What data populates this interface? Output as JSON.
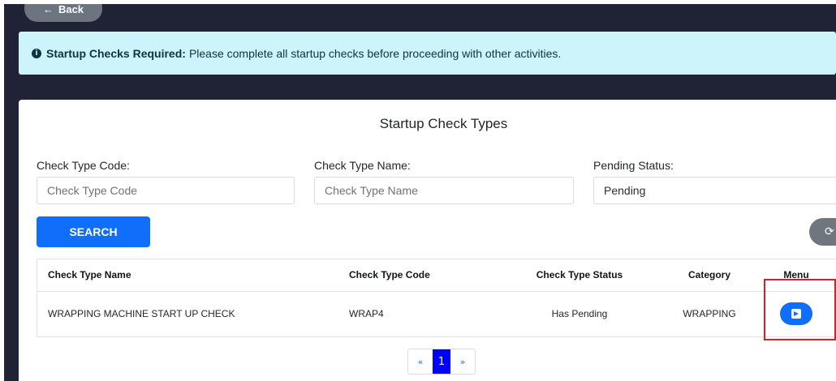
{
  "back_button": {
    "label": "Back",
    "icon": "arrow-left-icon"
  },
  "alert": {
    "icon": "info-icon",
    "title": "Startup Checks Required:",
    "message": "Please complete all startup checks before proceeding with other activities."
  },
  "card": {
    "title": "Startup Check Types",
    "filters": {
      "code": {
        "label": "Check Type Code:",
        "placeholder": "Check Type Code",
        "value": ""
      },
      "name": {
        "label": "Check Type Name:",
        "placeholder": "Check Type Name",
        "value": ""
      },
      "status": {
        "label": "Pending Status:",
        "value": "Pending"
      }
    },
    "search_label": "SEARCH",
    "refresh_icon": "refresh-icon"
  },
  "table": {
    "headers": [
      "Check Type Name",
      "Check Type Code",
      "Check Type Status",
      "Category",
      "Menu"
    ],
    "rows": [
      {
        "name": "WRAPPING MACHINE START UP CHECK",
        "code": "WRAP4",
        "status": "Has Pending",
        "category": "WRAPPING",
        "menu_icon": "enter-icon"
      }
    ]
  },
  "pagination": {
    "prev": "«",
    "current": "1",
    "next": "»"
  },
  "colors": {
    "background": "#1f2335",
    "alert_bg": "#cdf4fa",
    "primary": "#0f6ffb",
    "highlight": "#e31b23",
    "active_page": "#0000ff"
  }
}
